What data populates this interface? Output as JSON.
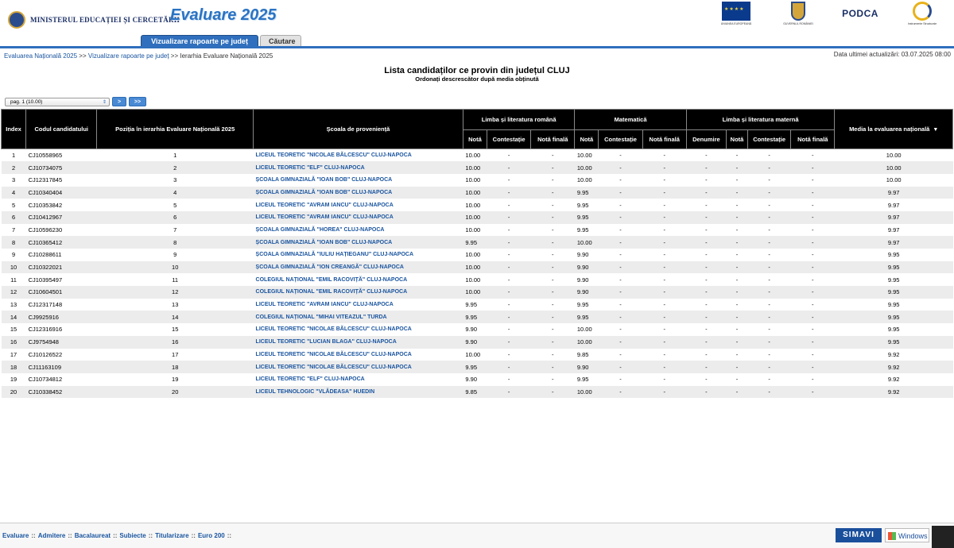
{
  "header": {
    "ministry": "MINISTERUL EDUCAȚIEI ȘI CERCETĂRII",
    "app_title": "Evaluare 2025",
    "logos": {
      "eu": "UNIUNEA EUROPEANĂ",
      "gov": "GUVERNUL ROMÂNIEI",
      "podca": "PODCA",
      "instr": "Instrumente Structurale"
    }
  },
  "tabs": [
    {
      "label": "Vizualizare rapoarte pe județ",
      "active": true
    },
    {
      "label": "Căutare",
      "active": false
    }
  ],
  "breadcrumb": {
    "items": [
      "Evaluarea Națională 2025",
      "Vizualizare rapoarte pe județ",
      "Ierarhia Evaluare Națională 2025"
    ],
    "sep": " >> "
  },
  "last_update": "Data ultimei actualizări: 03.07.2025 08:00",
  "list": {
    "title": "Lista candidaților ce provin din județul CLUJ",
    "subtitle": "Ordonați descrescător după media obținută"
  },
  "pager": {
    "selected": "pag. 1 (10.00)",
    "next_label": ">",
    "last_label": ">>"
  },
  "table": {
    "headers": {
      "index": "Index",
      "code": "Codul candidatului",
      "rank": "Poziția în ierarhia Evaluare Națională 2025",
      "school": "Școala de proveniență",
      "romana": "Limba și literatura română",
      "mate": "Matematică",
      "materna": "Limba și literatura maternă",
      "media": "Media la evaluarea națională",
      "nota": "Notă",
      "contestatie": "Contestație",
      "nota_finala": "Notă finală",
      "denumire": "Denumire"
    },
    "rows": [
      [
        "1",
        "CJ10558965",
        "1",
        "LICEUL TEORETIC \"NICOLAE BĂLCESCU\" CLUJ-NAPOCA",
        "10.00",
        "-",
        "-",
        "10.00",
        "-",
        "-",
        "-",
        "-",
        "-",
        "-",
        "10.00"
      ],
      [
        "2",
        "CJ10734075",
        "2",
        "LICEUL TEORETIC \"ELF\" CLUJ-NAPOCA",
        "10.00",
        "-",
        "-",
        "10.00",
        "-",
        "-",
        "-",
        "-",
        "-",
        "-",
        "10.00"
      ],
      [
        "3",
        "CJ12317845",
        "3",
        "ȘCOALA GIMNAZIALĂ \"IOAN BOB\" CLUJ-NAPOCA",
        "10.00",
        "-",
        "-",
        "10.00",
        "-",
        "-",
        "-",
        "-",
        "-",
        "-",
        "10.00"
      ],
      [
        "4",
        "CJ10340404",
        "4",
        "ȘCOALA GIMNAZIALĂ \"IOAN BOB\" CLUJ-NAPOCA",
        "10.00",
        "-",
        "-",
        "9.95",
        "-",
        "-",
        "-",
        "-",
        "-",
        "-",
        "9.97"
      ],
      [
        "5",
        "CJ10353842",
        "5",
        "LICEUL TEORETIC \"AVRAM IANCU\" CLUJ-NAPOCA",
        "10.00",
        "-",
        "-",
        "9.95",
        "-",
        "-",
        "-",
        "-",
        "-",
        "-",
        "9.97"
      ],
      [
        "6",
        "CJ10412967",
        "6",
        "LICEUL TEORETIC \"AVRAM IANCU\" CLUJ-NAPOCA",
        "10.00",
        "-",
        "-",
        "9.95",
        "-",
        "-",
        "-",
        "-",
        "-",
        "-",
        "9.97"
      ],
      [
        "7",
        "CJ10596230",
        "7",
        "ȘCOALA GIMNAZIALĂ \"HOREA\" CLUJ-NAPOCA",
        "10.00",
        "-",
        "-",
        "9.95",
        "-",
        "-",
        "-",
        "-",
        "-",
        "-",
        "9.97"
      ],
      [
        "8",
        "CJ10365412",
        "8",
        "ȘCOALA GIMNAZIALĂ \"IOAN BOB\" CLUJ-NAPOCA",
        "9.95",
        "-",
        "-",
        "10.00",
        "-",
        "-",
        "-",
        "-",
        "-",
        "-",
        "9.97"
      ],
      [
        "9",
        "CJ10288611",
        "9",
        "ȘCOALA GIMNAZIALĂ \"IULIU HAȚIEGANU\" CLUJ-NAPOCA",
        "10.00",
        "-",
        "-",
        "9.90",
        "-",
        "-",
        "-",
        "-",
        "-",
        "-",
        "9.95"
      ],
      [
        "10",
        "CJ10322021",
        "10",
        "ȘCOALA GIMNAZIALĂ \"ION CREANGĂ\" CLUJ-NAPOCA",
        "10.00",
        "-",
        "-",
        "9.90",
        "-",
        "-",
        "-",
        "-",
        "-",
        "-",
        "9.95"
      ],
      [
        "11",
        "CJ10395497",
        "11",
        "COLEGIUL NAȚIONAL \"EMIL RACOVIȚĂ\" CLUJ-NAPOCA",
        "10.00",
        "-",
        "-",
        "9.90",
        "-",
        "-",
        "-",
        "-",
        "-",
        "-",
        "9.95"
      ],
      [
        "12",
        "CJ10604501",
        "12",
        "COLEGIUL NAȚIONAL \"EMIL RACOVIȚĂ\" CLUJ-NAPOCA",
        "10.00",
        "-",
        "-",
        "9.90",
        "-",
        "-",
        "-",
        "-",
        "-",
        "-",
        "9.95"
      ],
      [
        "13",
        "CJ12317148",
        "13",
        "LICEUL TEORETIC \"AVRAM IANCU\" CLUJ-NAPOCA",
        "9.95",
        "-",
        "-",
        "9.95",
        "-",
        "-",
        "-",
        "-",
        "-",
        "-",
        "9.95"
      ],
      [
        "14",
        "CJ9925916",
        "14",
        "COLEGIUL NAȚIONAL \"MIHAI VITEAZUL\" TURDA",
        "9.95",
        "-",
        "-",
        "9.95",
        "-",
        "-",
        "-",
        "-",
        "-",
        "-",
        "9.95"
      ],
      [
        "15",
        "CJ12316916",
        "15",
        "LICEUL TEORETIC \"NICOLAE BĂLCESCU\" CLUJ-NAPOCA",
        "9.90",
        "-",
        "-",
        "10.00",
        "-",
        "-",
        "-",
        "-",
        "-",
        "-",
        "9.95"
      ],
      [
        "16",
        "CJ9754948",
        "16",
        "LICEUL TEORETIC \"LUCIAN BLAGA\" CLUJ-NAPOCA",
        "9.90",
        "-",
        "-",
        "10.00",
        "-",
        "-",
        "-",
        "-",
        "-",
        "-",
        "9.95"
      ],
      [
        "17",
        "CJ10126522",
        "17",
        "LICEUL TEORETIC \"NICOLAE BĂLCESCU\" CLUJ-NAPOCA",
        "10.00",
        "-",
        "-",
        "9.85",
        "-",
        "-",
        "-",
        "-",
        "-",
        "-",
        "9.92"
      ],
      [
        "18",
        "CJ11163109",
        "18",
        "LICEUL TEORETIC \"NICOLAE BĂLCESCU\" CLUJ-NAPOCA",
        "9.95",
        "-",
        "-",
        "9.90",
        "-",
        "-",
        "-",
        "-",
        "-",
        "-",
        "9.92"
      ],
      [
        "19",
        "CJ10734812",
        "19",
        "LICEUL TEORETIC \"ELF\" CLUJ-NAPOCA",
        "9.90",
        "-",
        "-",
        "9.95",
        "-",
        "-",
        "-",
        "-",
        "-",
        "-",
        "9.92"
      ],
      [
        "20",
        "CJ10338452",
        "20",
        "LICEUL TEHNOLOGIC \"VLĂDEASA\" HUEDIN",
        "9.85",
        "-",
        "-",
        "10.00",
        "-",
        "-",
        "-",
        "-",
        "-",
        "-",
        "9.92"
      ]
    ]
  },
  "footer": {
    "links": [
      "Evaluare",
      "Admitere",
      "Bacalaureat",
      "Subiecte",
      "Titularizare",
      "Euro 200"
    ],
    "sep": "::",
    "simavi": "SIMAVI",
    "windows": "Windows"
  }
}
